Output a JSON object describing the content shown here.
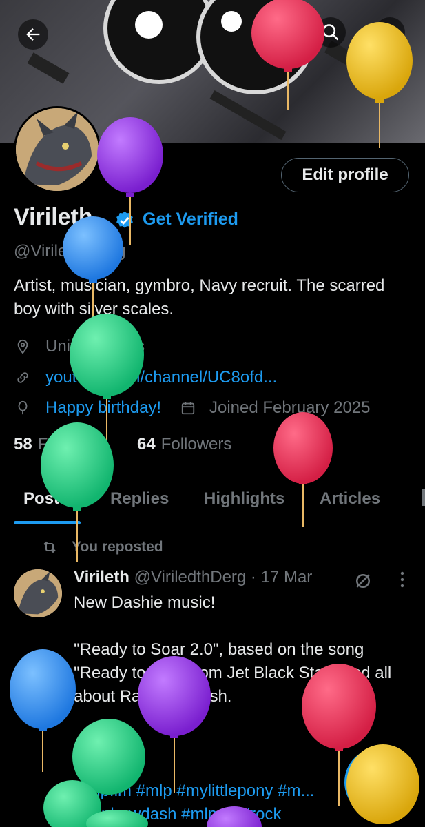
{
  "profile": {
    "name": "Virileth",
    "get_verified": "Get Verified",
    "handle": "@ViriledthDerg",
    "bio": "Artist, musician, gymbro, Navy recruit. The scarred boy with silver scales.",
    "location": "United States",
    "link": "youtube.com/channel/UC8ofd...",
    "birthday": "Happy birthday!",
    "joined": "Joined February 2025",
    "following_count": "58",
    "following_label": "Following",
    "followers_count": "64",
    "followers_label": "Followers",
    "edit_profile": "Edit profile"
  },
  "tabs": [
    {
      "label": "Posts"
    },
    {
      "label": "Replies"
    },
    {
      "label": "Highlights"
    },
    {
      "label": "Articles"
    }
  ],
  "post": {
    "repost_label": "You reposted",
    "author_name": "Virileth",
    "author_handle": "@ViriledthDerg",
    "date": "· 17 Mar",
    "line1": "New Dashie music!",
    "line2": "\"Ready to Soar 2.0\", based on the song \"Ready to Roll\" from Jet Black Stare and all about Rainbow Dash.",
    "hashtags1": "#mlpfim #mlp #mylittlepony #m...",
    "hashtags2": "#rainbowdash #mlpart #rock"
  },
  "colors": {
    "accent": "#1d9bf0",
    "background": "#000000",
    "muted": "#71767b"
  },
  "icons": [
    "back-arrow-icon",
    "grok-icon",
    "search-icon",
    "more-icon",
    "verified-badge-icon",
    "location-icon",
    "link-icon",
    "balloon-icon",
    "calendar-icon",
    "repost-icon",
    "compose-icon"
  ]
}
